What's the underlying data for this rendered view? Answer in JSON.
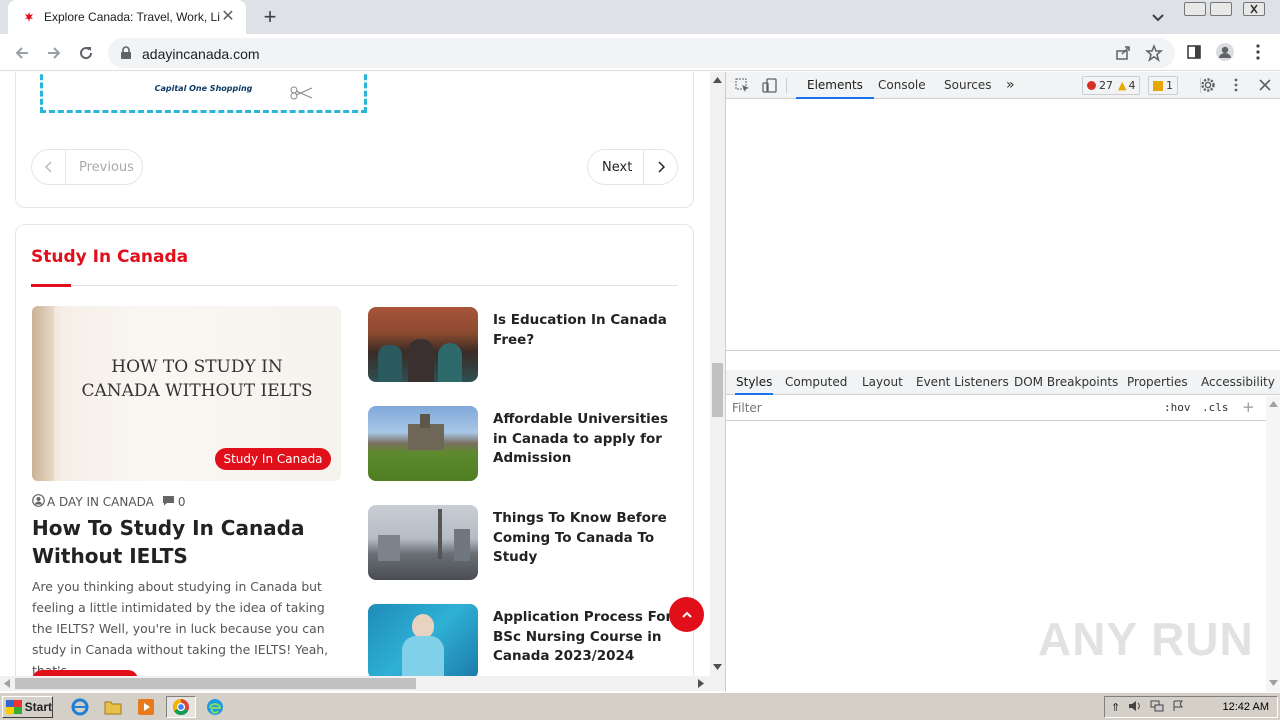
{
  "browser": {
    "tab_title": "Explore Canada: Travel, Work, Live,",
    "url": "adayincanada.com"
  },
  "page": {
    "pagination": {
      "previous_label": "Previous",
      "next_label": "Next"
    },
    "section_title": "Study In Canada",
    "featured": {
      "image_text": "HOW TO STUDY IN CANADA WITHOUT IELTS",
      "category": "Study In Canada",
      "author": "A DAY IN CANADA",
      "comments": "0",
      "title": "How To Study In Canada Without IELTS",
      "excerpt": "Are you thinking about studying in Canada but feeling a little intimidated by the idea of taking the IELTS? Well, you're in luck because you can study in Canada without taking the IELTS! Yeah, that's..."
    },
    "posts": [
      {
        "title": "Is Education In Canada Free?"
      },
      {
        "title": "Affordable Universities in Canada to apply for Admission"
      },
      {
        "title": "Things To Know Before Coming To Canada To Study"
      },
      {
        "title": "Application Process For BSc Nursing Course in Canada 2023/2024"
      }
    ],
    "coupon_logo": "Capital One Shopping"
  },
  "devtools": {
    "tabs": [
      "Elements",
      "Console",
      "Sources"
    ],
    "errors": "27",
    "warnings": "4",
    "issues": "1",
    "style_tabs": [
      "Styles",
      "Computed",
      "Layout",
      "Event Listeners",
      "DOM Breakpoints",
      "Properties",
      "Accessibility"
    ],
    "filter_placeholder": "Filter",
    "hov": ":hov",
    "cls": ".cls"
  },
  "watermark": "ANY RUN",
  "taskbar": {
    "start_label": "Start",
    "clock": "12:42 AM"
  },
  "colors": {
    "accent_red": "#e00f1a",
    "devtools_blue": "#1a73e8"
  }
}
